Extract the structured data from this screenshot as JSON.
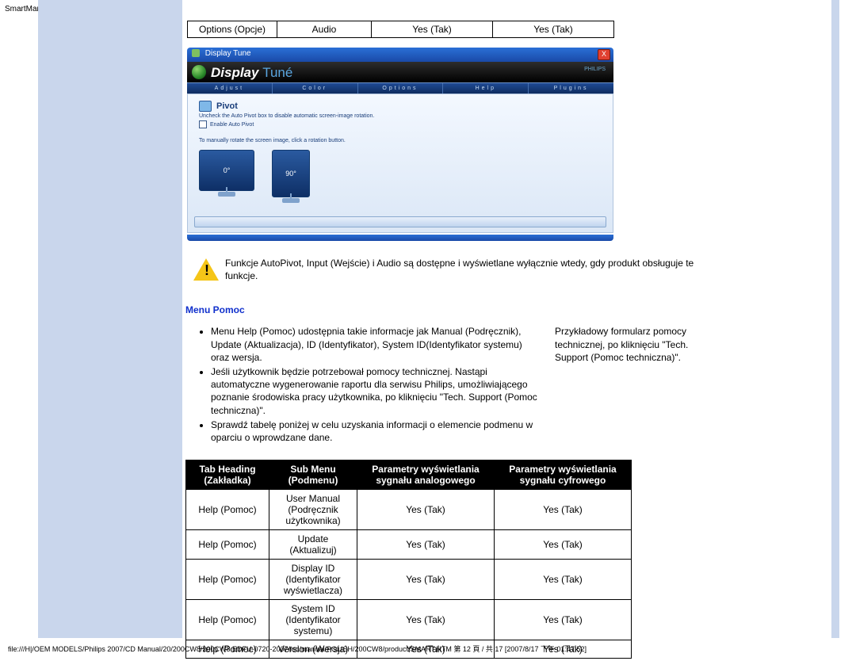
{
  "header_title": "SmartManage",
  "top_row": {
    "c1": "Options (Opcje)",
    "c2": "Audio",
    "c3": "Yes (Tak)",
    "c4": "Yes (Tak)"
  },
  "screenshot": {
    "titlebar_text": "Display Tune",
    "close_glyph": "X",
    "banner_display": "Display",
    "banner_tune": "Tuné",
    "banner_right": "PHILIPS",
    "tab1": "Adjust",
    "tab2": "Color",
    "tab3": "Options",
    "tab4": "Help",
    "tab5": "Plugins",
    "panel_head": "Pivot",
    "panel_sub": "Uncheck the Auto Pivot box to disable automatic screen-image rotation.",
    "panel_check": "Enable Auto Pivot",
    "panel_note": "To manually rotate the screen image, click a rotation button.",
    "mon1": "0°",
    "mon2": "90°"
  },
  "warn_exclaim": "!",
  "note_text": "Funkcje AutoPivot, Input (Wejście) i Audio są dostępne i wyświetlane wyłącznie wtedy, gdy produkt obsługuje te funkcje.",
  "section_title": "Menu Pomoc",
  "bullets": {
    "b1": "Menu Help (Pomoc) udostępnia takie informacje jak Manual (Podręcznik), Update (Aktualizacja), ID (Identyfikator), System ID(Identyfikator systemu) oraz wersja.",
    "b2": "Jeśli użytkownik będzie potrzebował pomocy technicznej. Nastąpi automatyczne wygenerowanie raportu dla serwisu Philips, umożliwiającego poznanie środowiska pracy użytkownika, po kliknięciu \"Tech. Support (Pomoc techniczna)\".",
    "b3": "Sprawdź tabelę poniżej w celu uzyskania informacji o elemencie podmenu w oparciu o wprowdzane dane."
  },
  "side_text": "Przykładowy formularz pomocy technicznej, po kliknięciu \"Tech. Support (Pomoc techniczna)\".",
  "table": {
    "h1": "Tab Heading (Zakładka)",
    "h2": "Sub Menu (Podmenu)",
    "h3": "Parametry wyświetlania sygnału analogowego",
    "h4": "Parametry wyświetlania sygnału cyfrowego",
    "rows": [
      {
        "c1": "Help (Pomoc)",
        "c2": "User Manual (Podręcznik użytkownika)",
        "c3": "Yes (Tak)",
        "c4": "Yes (Tak)"
      },
      {
        "c1": "Help (Pomoc)",
        "c2": "Update (Aktualizuj)",
        "c3": "Yes (Tak)",
        "c4": "Yes (Tak)"
      },
      {
        "c1": "Help (Pomoc)",
        "c2": "Display ID (Identyfikator wyświetlacza)",
        "c3": "Yes (Tak)",
        "c4": "Yes (Tak)"
      },
      {
        "c1": "Help (Pomoc)",
        "c2": "System ID (Identyfikator systemu)",
        "c3": "Yes (Tak)",
        "c4": "Yes (Tak)"
      },
      {
        "c1": "Help (Pomoc)",
        "c2": "Version (Wersja)",
        "c3": "Yes (Tak)",
        "c4": "Yes (Tak)"
      }
    ]
  },
  "footer_path": "file:///H|/OEM MODELS/Philips 2007/CD Manual/20/200CW8/200CW8 EDFU-0720-2007/lcd/manual/POLISH/200CW8/product/SMART.HTM 第 12 頁 / 共 17  [2007/8/17 下午 01:47:52]"
}
